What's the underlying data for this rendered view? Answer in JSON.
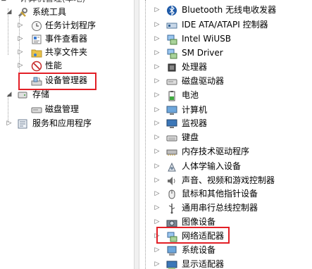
{
  "left_tree": {
    "top_cut_label": "计算机管理(本地)",
    "system_tools": "系统工具",
    "task_scheduler": "任务计划程序",
    "event_viewer": "事件查看器",
    "shared_folders": "共享文件夹",
    "performance": "性能",
    "device_manager": "设备管理器",
    "storage": "存储",
    "disk_management": "磁盘管理",
    "services_apps": "服务和应用程序"
  },
  "device_categories": [
    "Bluetooth 无线电收发器",
    "IDE ATA/ATAPI 控制器",
    "Intel WiUSB",
    "SM Driver",
    "处理器",
    "磁盘驱动器",
    "电池",
    "计算机",
    "监视器",
    "键盘",
    "内存技术驱动程序",
    "人体学输入设备",
    "声音、视频和游戏控制器",
    "鼠标和其他指针设备",
    "通用串行总线控制器",
    "图像设备",
    "网络适配器",
    "系统设备",
    "显示适配器"
  ],
  "colors": {
    "highlight_border": "#e21f26"
  }
}
